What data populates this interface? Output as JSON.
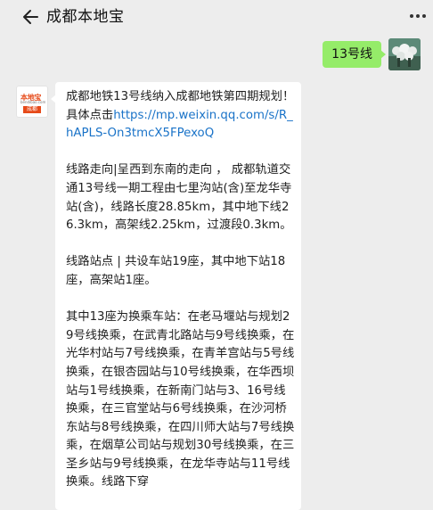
{
  "header": {
    "title": "成都本地宝",
    "back_icon": "chevron-left-icon",
    "more_icon": "more-dots-icon"
  },
  "outgoing": {
    "text": "13号线"
  },
  "incoming": {
    "avatar": {
      "line1": "本地宝",
      "line2": "bendibao.com",
      "line3": "成都"
    },
    "intro_text": "成都地铁13号线纳入成都地铁第四期规划！具体点击",
    "link": "https://mp.weixin.qq.com/s/R_hAPLS-On3tmcX5FPexoQ",
    "p1": "线路走向|呈西到东南的走向 ， 成都轨道交通13号线一期工程由七里沟站(含)至龙华寺站(含)，线路长度28.85km，其中地下线26.3km，高架线2.25km，过渡段0.3km。",
    "p2": "线路站点 | 共设车站19座，其中地下站18座，高架站1座。",
    "p3": "其中13座为换乘车站：在老马堰站与规划29号线换乘，在武青北路站与9号线换乘，在光华村站与7号线换乘，在青羊宫站与5号线换乘，在银杏园站与10号线换乘，在华西坝站与1号线换乘，在新南门站与3、16号线换乘，在三官堂站与6号线换乘，在沙河桥东站与8号线换乘，在四川师大站与7号线换乘，在烟草公司站与规划30号线换乘，在三圣乡站与9号线换乘，在龙华寺站与11号线换乘。线路下穿"
  }
}
